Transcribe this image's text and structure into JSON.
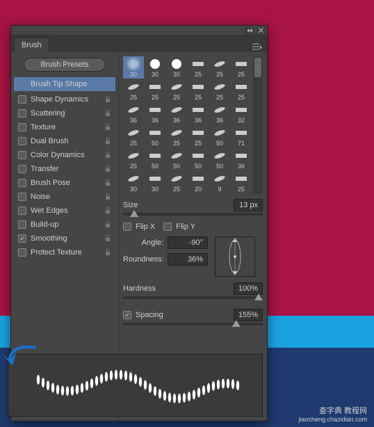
{
  "panel": {
    "title": "Brush"
  },
  "presets_button": "Brush Presets",
  "tip_shape_label": "Brush Tip Shape",
  "options": [
    {
      "label": "Shape Dynamics",
      "checked": false,
      "lock": true
    },
    {
      "label": "Scattering",
      "checked": false,
      "lock": true
    },
    {
      "label": "Texture",
      "checked": false,
      "lock": true
    },
    {
      "label": "Dual Brush",
      "checked": false,
      "lock": true
    },
    {
      "label": "Color Dynamics",
      "checked": false,
      "lock": true
    },
    {
      "label": "Transfer",
      "checked": false,
      "lock": true
    },
    {
      "label": "Brush Pose",
      "checked": false,
      "lock": true
    },
    {
      "label": "Noise",
      "checked": false,
      "lock": true
    },
    {
      "label": "Wet Edges",
      "checked": false,
      "lock": true
    },
    {
      "label": "Build-up",
      "checked": false,
      "lock": true
    },
    {
      "label": "Smoothing",
      "checked": true,
      "lock": true
    },
    {
      "label": "Protect Texture",
      "checked": false,
      "lock": true
    }
  ],
  "brush_grid": {
    "values": [
      [
        "30",
        "30",
        "30",
        "25",
        "25",
        "25"
      ],
      [
        "25",
        "25",
        "25",
        "25",
        "25",
        "25"
      ],
      [
        "36",
        "36",
        "36",
        "36",
        "36",
        "32"
      ],
      [
        "25",
        "50",
        "25",
        "25",
        "50",
        "71"
      ],
      [
        "25",
        "50",
        "50",
        "50",
        "50",
        "36"
      ],
      [
        "30",
        "30",
        "25",
        "20",
        "9",
        "25"
      ]
    ]
  },
  "size": {
    "label": "Size",
    "value": "13 px",
    "pos": 5
  },
  "flip_x": {
    "label": "Flip X",
    "checked": false
  },
  "flip_y": {
    "label": "Flip Y",
    "checked": false
  },
  "angle": {
    "label": "Angle:",
    "value": "-90°"
  },
  "roundness": {
    "label": "Roundness:",
    "value": "36%"
  },
  "hardness": {
    "label": "Hardness",
    "value": "100%",
    "pos": 100
  },
  "spacing": {
    "label": "Spacing",
    "value": "155%",
    "checked": true,
    "pos": 78
  },
  "watermark": {
    "line1": "查字典 教程网",
    "line2": "jiaocheng.chazidian.com"
  }
}
